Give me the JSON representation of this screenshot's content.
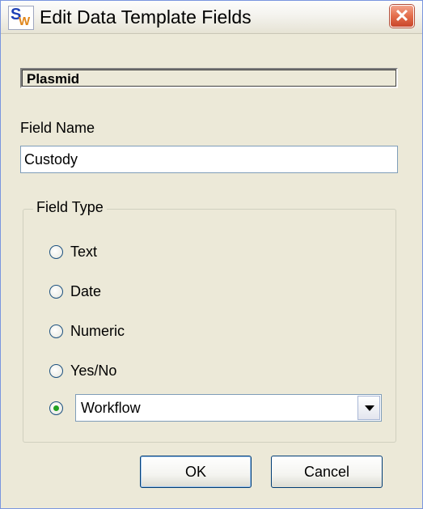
{
  "window": {
    "title": "Edit Data Template Fields",
    "icon": "app-sw-icon",
    "icon_letters": {
      "primary": "S",
      "secondary": "W"
    },
    "close_icon": "close-icon"
  },
  "template": {
    "name": "Plasmid"
  },
  "field_name": {
    "label": "Field Name",
    "value": "Custody"
  },
  "field_type": {
    "legend": "Field Type",
    "options": [
      "Text",
      "Date",
      "Numeric",
      "Yes/No"
    ],
    "selected_index": 4,
    "workflow_select": {
      "value": "Workflow"
    }
  },
  "buttons": {
    "ok": "OK",
    "cancel": "Cancel"
  },
  "colors": {
    "radio_dot": "#21a121",
    "close_button": "#e36d4b",
    "dialog_bg": "#ece9d8"
  }
}
